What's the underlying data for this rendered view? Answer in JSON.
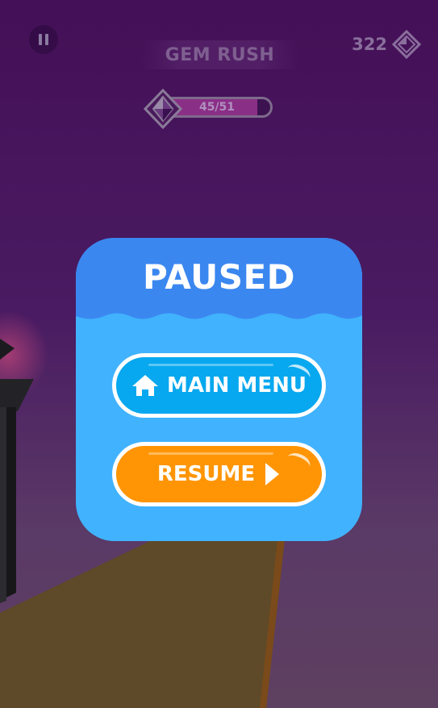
{
  "hud": {
    "level_title": "GEM RUSH",
    "gem_count": "322",
    "progress_text": "45/51",
    "progress_fraction": 0.882
  },
  "pause_menu": {
    "title": "PAUSED",
    "main_menu_label": "MAIN MENU",
    "resume_label": "RESUME"
  },
  "icons": {
    "pause": "pause-icon",
    "gem": "diamond-gem-icon",
    "home": "home-icon",
    "play": "play-arrow-icon"
  },
  "colors": {
    "sky_top": "#441057",
    "sky_bottom": "#5e4060",
    "modal_header": "#3b87f0",
    "modal_body": "#41b2fd",
    "main_menu_button": "#07a8ef",
    "resume_button": "#ff9505"
  }
}
